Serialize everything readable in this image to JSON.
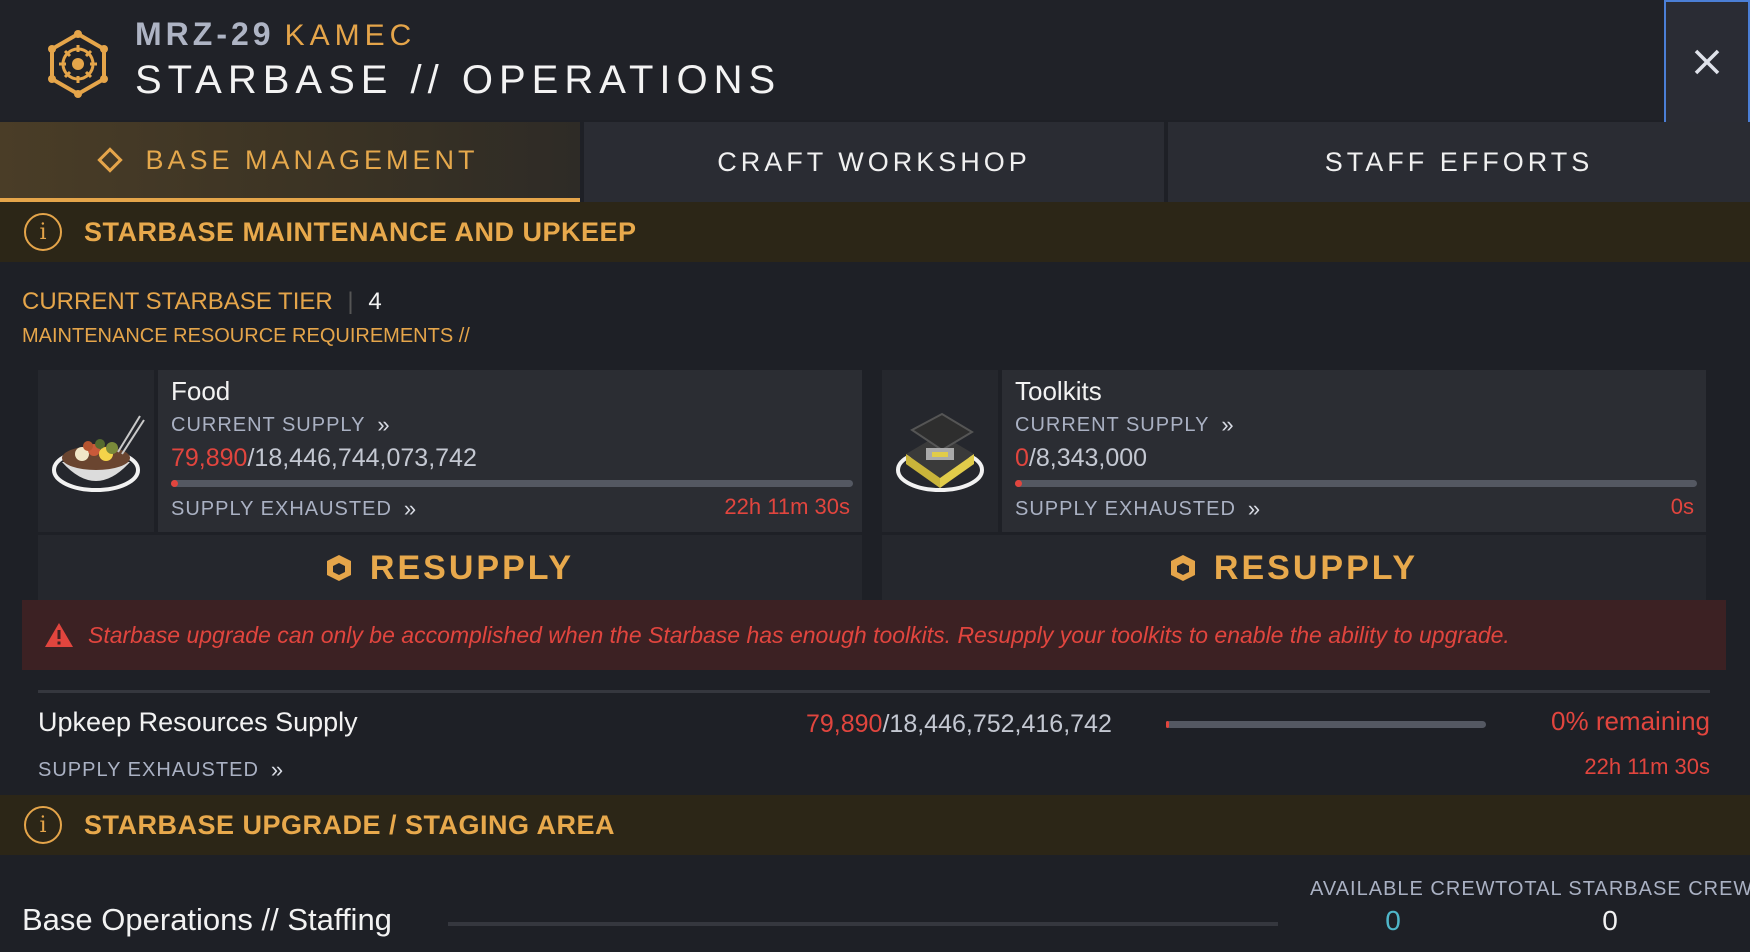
{
  "header": {
    "system_id": "MRZ-29",
    "faction": "KAMEC",
    "title": "STARBASE // OPERATIONS",
    "logo_icon": "starbase-emblem-icon",
    "close_icon": "close-icon"
  },
  "tabs": [
    {
      "label": "BASE MANAGEMENT",
      "active": true
    },
    {
      "label": "CRAFT WORKSHOP",
      "active": false
    },
    {
      "label": "STAFF EFFORTS",
      "active": false
    }
  ],
  "maintenance": {
    "section_title": "STARBASE MAINTENANCE AND UPKEEP",
    "tier_label": "CURRENT STARBASE TIER",
    "tier_value": "4",
    "requirements_label": "MAINTENANCE RESOURCE REQUIREMENTS //",
    "resources": [
      {
        "name": "Food",
        "supply_label": "CURRENT SUPPLY",
        "current": "79,890",
        "max": "/18,446,744,073,742",
        "fill_fraction": 0.0,
        "exhausted_label": "SUPPLY EXHAUSTED",
        "timer": "22h 11m 30s",
        "button_label": "RESUPPLY"
      },
      {
        "name": "Toolkits",
        "supply_label": "CURRENT SUPPLY",
        "current": "0",
        "max": "/8,343,000",
        "fill_fraction": 0.0,
        "exhausted_label": "SUPPLY EXHAUSTED",
        "timer": "0s",
        "button_label": "RESUPPLY"
      }
    ],
    "warning": "Starbase upgrade can only be accomplished when the Starbase has enough toolkits. Resupply your toolkits to enable the ability to upgrade.",
    "upkeep": {
      "title": "Upkeep Resources Supply",
      "current": "79,890",
      "max": "/18,446,752,416,742",
      "fill_fraction": 0.0,
      "remaining": "0% remaining",
      "exhausted_label": "SUPPLY EXHAUSTED",
      "timer": "22h 11m 30s"
    }
  },
  "upgrade": {
    "section_title": "STARBASE UPGRADE / STAGING AREA",
    "staffing_title": "Base Operations // Staffing",
    "available_crew_label": "AVAILABLE CREW",
    "available_crew_value": "0",
    "total_crew_label": "TOTAL STARBASE CREW",
    "total_crew_value": "0"
  },
  "colors": {
    "accent": "#e5a54a",
    "danger": "#e1453e",
    "crew_available": "#4fb6c9"
  }
}
